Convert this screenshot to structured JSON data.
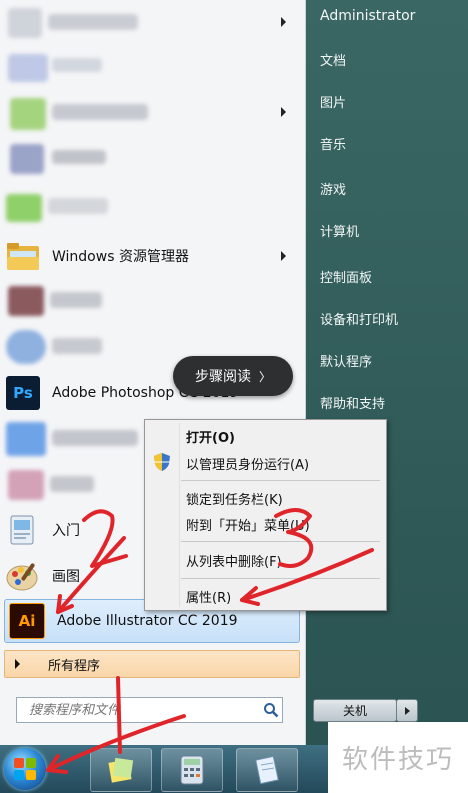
{
  "programs": {
    "windows_explorer": "Windows 资源管理器",
    "photoshop": "Adobe Photoshop CC 2019",
    "photoshop_icon": "Ps",
    "getting_started": "入门",
    "paint": "画图",
    "illustrator": "Adobe Illustrator CC 2019",
    "illustrator_icon": "Ai",
    "all_programs": "所有程序"
  },
  "search": {
    "placeholder": "搜索程序和文件"
  },
  "right_pane": {
    "user": "Administrator",
    "links": [
      "文档",
      "图片",
      "音乐",
      "游戏",
      "计算机",
      "控制面板",
      "设备和打印机",
      "默认程序",
      "帮助和支持"
    ],
    "shutdown": "关机"
  },
  "tooltip": {
    "text": "步骤阅读",
    "chevron": "〉"
  },
  "context_menu": {
    "items": [
      "打开(O)",
      "以管理员身份运行(A)",
      "锁定到任务栏(K)",
      "附到「开始」菜单(U)",
      "从列表中删除(F)",
      "属性(R)"
    ]
  },
  "annotations": {
    "step1": "1",
    "step2": "2",
    "step3": "3",
    "color": "#e0252a"
  },
  "watermark": "软件技巧",
  "colors": {
    "right_pane": "#2f5a57",
    "selected_item": "#c7e0f8",
    "all_programs_bar": "#f9d6a8",
    "photoshop": "#0b1d33",
    "illustrator": "#2b0a02",
    "illustrator_text": "#ff9a00"
  },
  "icons": [
    "folder-icon",
    "photoshop-icon",
    "getting-started-icon",
    "paint-icon",
    "illustrator-icon",
    "search-icon",
    "shield-icon",
    "windows-logo-icon",
    "sticky-notes-icon",
    "calculator-icon",
    "notepad-icon"
  ]
}
